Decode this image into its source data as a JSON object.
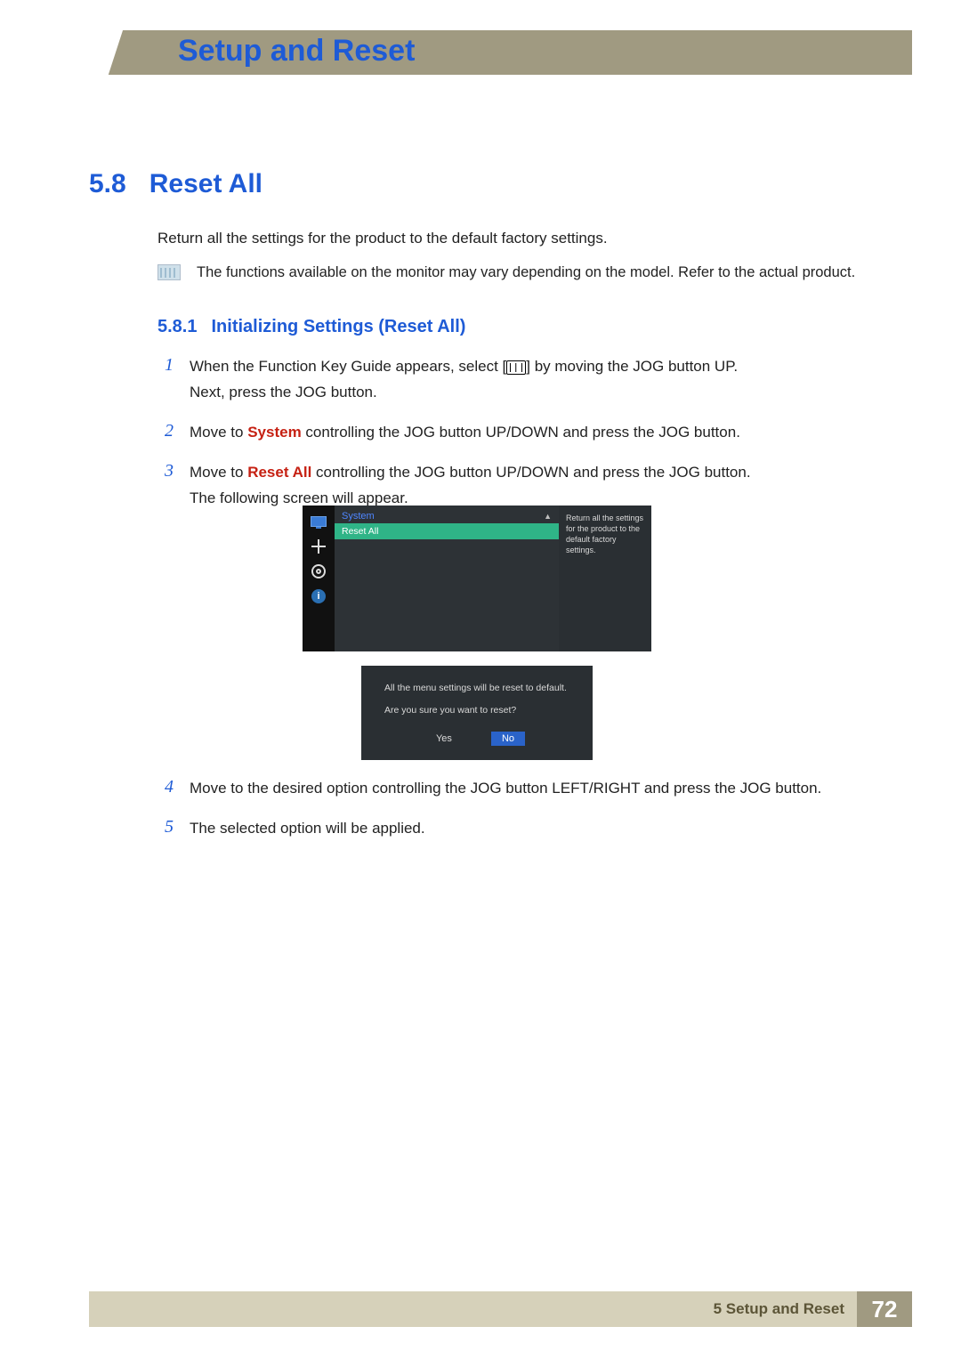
{
  "header": {
    "chapter_title": "Setup and Reset"
  },
  "section": {
    "number": "5.8",
    "title": "Reset All",
    "intro": "Return all the settings for the product to the default factory settings.",
    "note": "The functions available on the monitor may vary depending on the model. Refer to the actual product."
  },
  "subsection": {
    "number": "5.8.1",
    "title": "Initializing Settings (Reset All)"
  },
  "steps": {
    "s1_pre": "When the Function Key Guide appears, select [",
    "s1_post": "] by moving the JOG button UP.",
    "s1_line2": "Next, press the JOG button.",
    "s2_pre": "Move to ",
    "s2_kw": "System",
    "s2_post": " controlling the JOG button UP/DOWN and press the JOG button.",
    "s3_pre": "Move to ",
    "s3_kw": "Reset All",
    "s3_post": " controlling the JOG button UP/DOWN and press the JOG button.",
    "s3_line2": "The following screen will appear.",
    "s4": "Move to the desired option controlling the JOG button LEFT/RIGHT and press the JOG button.",
    "s5": "The selected option will be applied."
  },
  "step_nums": {
    "n1": "1",
    "n2": "2",
    "n3": "3",
    "n4": "4",
    "n5": "5"
  },
  "osd": {
    "system_label": "System",
    "up_arrow": "▲",
    "reset_all": "Reset All",
    "help": "Return all the settings for the product to the default factory settings.",
    "dialog_msg": "All the menu settings will be reset to default.",
    "dialog_q": "Are you sure you want to reset?",
    "yes": "Yes",
    "no": "No",
    "info_glyph": "i"
  },
  "footer": {
    "text": "5 Setup and Reset",
    "page": "72"
  }
}
